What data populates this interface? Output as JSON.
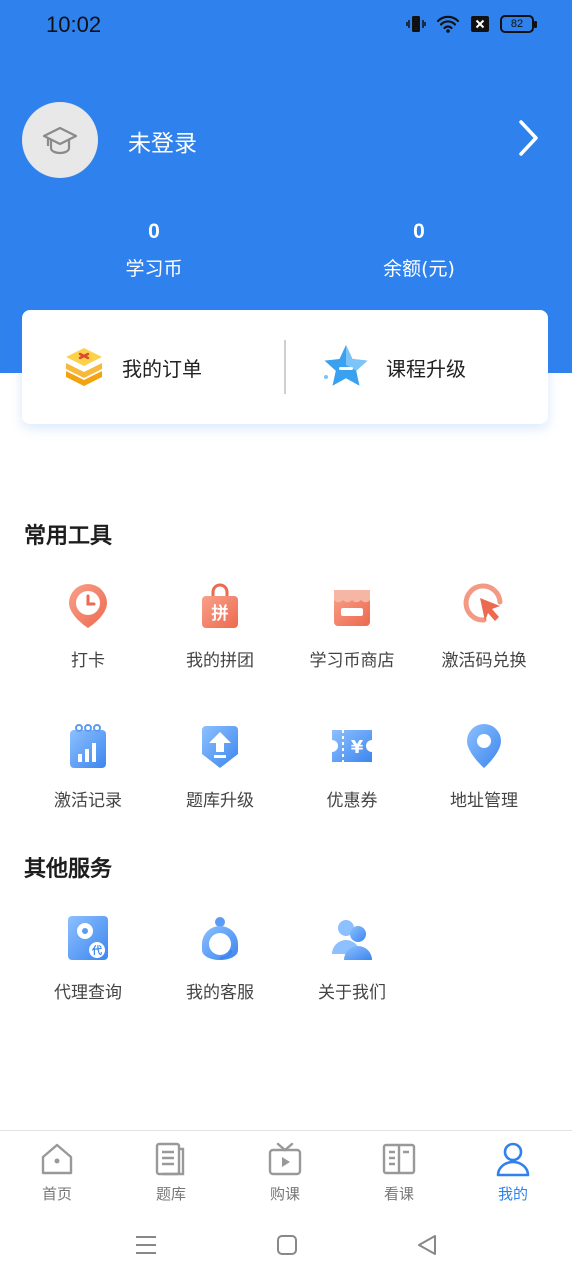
{
  "status_bar": {
    "time": "10:02",
    "battery": "82"
  },
  "profile": {
    "login_text": "未登录"
  },
  "stats": [
    {
      "value": "0",
      "label": "学习币"
    },
    {
      "value": "0",
      "label": "余额(元)"
    }
  ],
  "actions": {
    "orders": "我的订单",
    "upgrade": "课程升级"
  },
  "sections": {
    "common_tools": "常用工具",
    "other_services": "其他服务"
  },
  "tools": [
    {
      "label": "打卡",
      "icon": "clock-pin-icon"
    },
    {
      "label": "我的拼团",
      "icon": "group-buy-bag-icon"
    },
    {
      "label": "学习币商店",
      "icon": "shop-icon"
    },
    {
      "label": "激活码兑换",
      "icon": "cursor-click-icon"
    },
    {
      "label": "激活记录",
      "icon": "activation-record-icon"
    },
    {
      "label": "题库升级",
      "icon": "upgrade-arrow-icon"
    },
    {
      "label": "优惠券",
      "icon": "coupon-icon"
    },
    {
      "label": "地址管理",
      "icon": "location-pin-icon"
    }
  ],
  "services": [
    {
      "label": "代理查询",
      "icon": "agent-query-icon"
    },
    {
      "label": "我的客服",
      "icon": "customer-service-icon"
    },
    {
      "label": "关于我们",
      "icon": "about-us-icon"
    }
  ],
  "bottom_nav": [
    {
      "label": "首页",
      "icon": "home-icon"
    },
    {
      "label": "题库",
      "icon": "question-bank-icon"
    },
    {
      "label": "购课",
      "icon": "tv-play-icon"
    },
    {
      "label": "看课",
      "icon": "open-book-icon"
    },
    {
      "label": "我的",
      "icon": "user-icon",
      "active": true
    }
  ],
  "colors": {
    "primary": "#2f82ee",
    "tool_orange": "#f07a5e",
    "tool_blue": "#4a90f0"
  }
}
